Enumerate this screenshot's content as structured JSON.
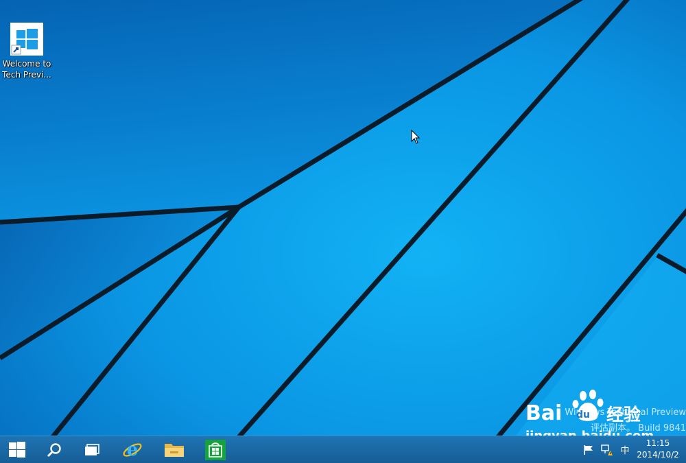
{
  "desktop": {
    "background_color": "#0a86d8",
    "icons": [
      {
        "label": "Welcome to\nTech Previ...",
        "icon": "windows-logo-shortcut-icon"
      }
    ]
  },
  "watermark": {
    "line1": "Windows Technical Preview",
    "line2": "评估副本。 Build 9841"
  },
  "baidu_stamp": {
    "brand": "Bai",
    "brand_suffix": "du",
    "product": "经验",
    "url": "jingyan.baidu.com"
  },
  "taskbar": {
    "color": "#1a68a6",
    "buttons": [
      {
        "name": "start",
        "icon": "windows-logo-icon"
      },
      {
        "name": "search",
        "icon": "search-icon"
      },
      {
        "name": "task-view",
        "icon": "task-view-icon"
      },
      {
        "name": "internet-explorer",
        "icon": "internet-explorer-icon"
      },
      {
        "name": "file-explorer",
        "icon": "folder-icon"
      },
      {
        "name": "store",
        "icon": "store-icon"
      }
    ],
    "tray": {
      "ime": "中",
      "time": "11:15",
      "date": "2014/10/2"
    }
  }
}
